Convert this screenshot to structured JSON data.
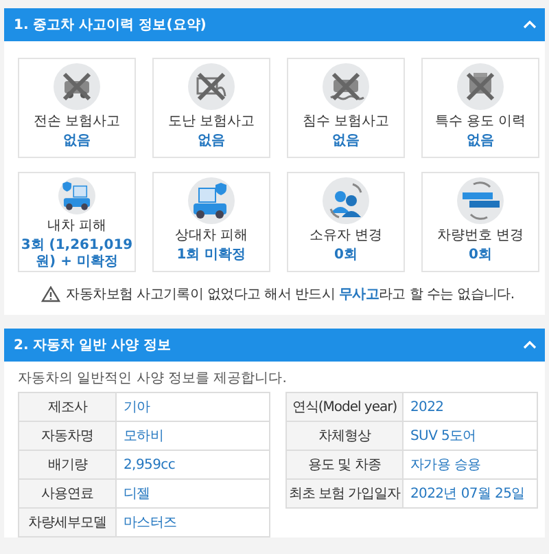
{
  "sections": [
    {
      "title": "1. 중고차 사고이력 정보(요약)",
      "expanded": true,
      "cards": [
        {
          "label": "전손 보험사고",
          "value": "없음"
        },
        {
          "label": "도난 보험사고",
          "value": "없음"
        },
        {
          "label": "침수 보험사고",
          "value": "없음"
        },
        {
          "label": "특수 용도 이력",
          "value": "없음"
        },
        {
          "label": "내차 피해",
          "value": "3회 (1,261,019 원) + 미확정"
        },
        {
          "label": "상대차 피해",
          "value": "1회 미확정"
        },
        {
          "label": "소유자 변경",
          "value": "0회"
        },
        {
          "label": "차량번호 변경",
          "value": "0회"
        }
      ],
      "notice": "자동차보험 사고기록이 없었다고 해서 반드시 **무사고**라고 할 수는 없습니다."
    },
    {
      "title": "2. 자동차 일반 사양 정보",
      "expanded": true,
      "description": "자동차의 일반적인 사양 정보를 제공합니다.",
      "tables": [
        {
          "rows": [
            {
              "label": "제조사",
              "value": "기아"
            },
            {
              "label": "자동차명",
              "value": "모하비"
            },
            {
              "label": "배기량",
              "value": "2,959cc"
            },
            {
              "label": "사용연료",
              "value": "디젤"
            },
            {
              "label": "차량세부모델",
              "value": "마스터즈"
            }
          ]
        },
        {
          "rows": [
            {
              "label": "연식(Model year)",
              "value": "2022"
            },
            {
              "label": "차체형상",
              "value": "SUV 5도어"
            },
            {
              "label": "용도 및 차종",
              "value": "자가용 승용"
            },
            {
              "label": "최초 보험 가입일자",
              "value": "2022년 07월 25일"
            }
          ]
        }
      ]
    }
  ]
}
